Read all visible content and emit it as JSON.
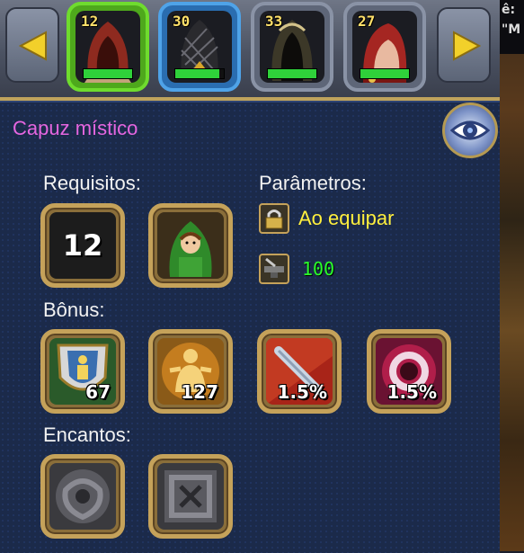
{
  "item": {
    "name": "Capuz místico"
  },
  "top_slots": [
    {
      "level": "12",
      "bar_fill": 1.0
    },
    {
      "level": "30",
      "bar_fill": 0.9
    },
    {
      "level": "33",
      "bar_fill": 1.0
    },
    {
      "level": "27",
      "bar_fill": 1.0
    }
  ],
  "sections": {
    "requirements": "Requisitos:",
    "parameters": "Parâmetros:",
    "bonus": "Bônus:",
    "enchants": "Encantos:"
  },
  "requirements": {
    "level": "12"
  },
  "parameters": {
    "equip_label": "Ao equipar",
    "durability": "100"
  },
  "bonuses": [
    {
      "value": "67",
      "icon": "shield-person-icon"
    },
    {
      "value": "127",
      "icon": "golden-figure-icon"
    },
    {
      "value": "1.5%",
      "icon": "sword-icon"
    },
    {
      "value": "1.5%",
      "icon": "magic-ring-icon"
    }
  ],
  "right_edge_text": {
    "line1": "ê:",
    "line2": "\"M"
  },
  "colors": {
    "title": "#e566e0",
    "equip": "#ffef3d",
    "durability": "#2aff2a",
    "frame_gold": "#c5a25a"
  }
}
